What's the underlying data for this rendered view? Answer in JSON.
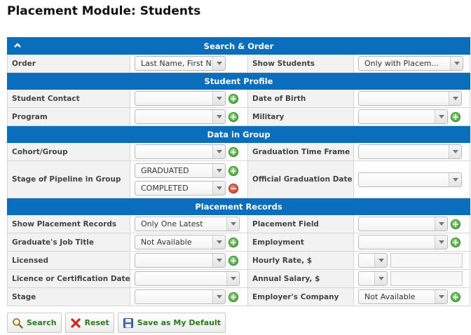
{
  "page": {
    "title": "Placement Module: Students"
  },
  "sections": {
    "search_order": "Search & Order",
    "student_profile": "Student Profile",
    "data_in_group": "Data in Group",
    "placement_records": "Placement Records"
  },
  "search_order": {
    "order_label": "Order",
    "order_value": "Last Name, First N...",
    "show_students_label": "Show Students",
    "show_students_value": "Only with Placem..."
  },
  "student_profile": {
    "student_contact_label": "Student Contact",
    "student_contact_value": "",
    "date_of_birth_label": "Date of Birth",
    "date_of_birth_value": "",
    "program_label": "Program",
    "program_value": "",
    "military_label": "Military",
    "military_value": ""
  },
  "data_in_group": {
    "cohort_label": "Cohort/Group",
    "cohort_value": "",
    "grad_time_frame_label": "Graduation Time Frame",
    "grad_time_frame_value": "",
    "stage_pipeline_label": "Stage of Pipeline in Group",
    "stage_values": [
      "GRADUATED",
      "COMPLETED"
    ],
    "official_grad_date_label": "Official Graduation Date",
    "official_grad_date_value": ""
  },
  "placement_records": {
    "show_records_label": "Show Placement Records",
    "show_records_value": "Only One Latest",
    "placement_field_label": "Placement Field",
    "placement_field_value": "",
    "job_title_label": "Graduate's Job Title",
    "job_title_value": "Not Available",
    "employment_label": "Employment",
    "employment_value": "",
    "licensed_label": "Licensed",
    "licensed_value": "",
    "hourly_rate_label": "Hourly Rate, $",
    "hourly_rate_value": "",
    "licence_date_label": "Licence or Certification Date",
    "licence_date_value": "",
    "annual_salary_label": "Annual Salary, $",
    "annual_salary_value": "",
    "stage_label": "Stage",
    "stage_value": "",
    "employer_company_label": "Employer's Company",
    "employer_company_value": "Not Available"
  },
  "buttons": {
    "search": "Search",
    "reset": "Reset",
    "save_default": "Save as My Default"
  },
  "colors": {
    "section_header": "#0a6ebd",
    "add_icon": "#3b9b2a",
    "remove_icon": "#c9321f",
    "button_text": "#2a7a1f"
  },
  "icons": {
    "collapse": "chevron-up-icon",
    "add": "plus-circle-icon",
    "remove": "minus-circle-icon",
    "search": "magnifier-icon",
    "reset": "red-x-icon",
    "save": "floppy-disk-icon"
  }
}
